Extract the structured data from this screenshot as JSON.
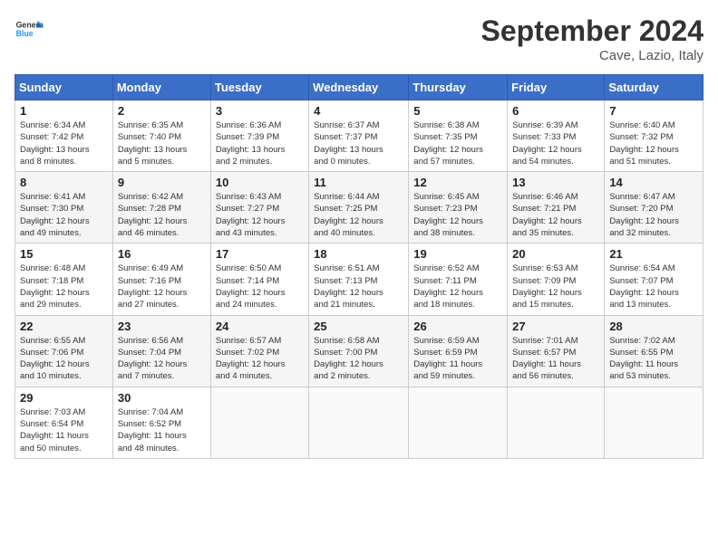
{
  "header": {
    "logo_general": "General",
    "logo_blue": "Blue",
    "month_title": "September 2024",
    "location": "Cave, Lazio, Italy"
  },
  "days_of_week": [
    "Sunday",
    "Monday",
    "Tuesday",
    "Wednesday",
    "Thursday",
    "Friday",
    "Saturday"
  ],
  "weeks": [
    [
      {
        "day": "1",
        "info": "Sunrise: 6:34 AM\nSunset: 7:42 PM\nDaylight: 13 hours\nand 8 minutes."
      },
      {
        "day": "2",
        "info": "Sunrise: 6:35 AM\nSunset: 7:40 PM\nDaylight: 13 hours\nand 5 minutes."
      },
      {
        "day": "3",
        "info": "Sunrise: 6:36 AM\nSunset: 7:39 PM\nDaylight: 13 hours\nand 2 minutes."
      },
      {
        "day": "4",
        "info": "Sunrise: 6:37 AM\nSunset: 7:37 PM\nDaylight: 13 hours\nand 0 minutes."
      },
      {
        "day": "5",
        "info": "Sunrise: 6:38 AM\nSunset: 7:35 PM\nDaylight: 12 hours\nand 57 minutes."
      },
      {
        "day": "6",
        "info": "Sunrise: 6:39 AM\nSunset: 7:33 PM\nDaylight: 12 hours\nand 54 minutes."
      },
      {
        "day": "7",
        "info": "Sunrise: 6:40 AM\nSunset: 7:32 PM\nDaylight: 12 hours\nand 51 minutes."
      }
    ],
    [
      {
        "day": "8",
        "info": "Sunrise: 6:41 AM\nSunset: 7:30 PM\nDaylight: 12 hours\nand 49 minutes."
      },
      {
        "day": "9",
        "info": "Sunrise: 6:42 AM\nSunset: 7:28 PM\nDaylight: 12 hours\nand 46 minutes."
      },
      {
        "day": "10",
        "info": "Sunrise: 6:43 AM\nSunset: 7:27 PM\nDaylight: 12 hours\nand 43 minutes."
      },
      {
        "day": "11",
        "info": "Sunrise: 6:44 AM\nSunset: 7:25 PM\nDaylight: 12 hours\nand 40 minutes."
      },
      {
        "day": "12",
        "info": "Sunrise: 6:45 AM\nSunset: 7:23 PM\nDaylight: 12 hours\nand 38 minutes."
      },
      {
        "day": "13",
        "info": "Sunrise: 6:46 AM\nSunset: 7:21 PM\nDaylight: 12 hours\nand 35 minutes."
      },
      {
        "day": "14",
        "info": "Sunrise: 6:47 AM\nSunset: 7:20 PM\nDaylight: 12 hours\nand 32 minutes."
      }
    ],
    [
      {
        "day": "15",
        "info": "Sunrise: 6:48 AM\nSunset: 7:18 PM\nDaylight: 12 hours\nand 29 minutes."
      },
      {
        "day": "16",
        "info": "Sunrise: 6:49 AM\nSunset: 7:16 PM\nDaylight: 12 hours\nand 27 minutes."
      },
      {
        "day": "17",
        "info": "Sunrise: 6:50 AM\nSunset: 7:14 PM\nDaylight: 12 hours\nand 24 minutes."
      },
      {
        "day": "18",
        "info": "Sunrise: 6:51 AM\nSunset: 7:13 PM\nDaylight: 12 hours\nand 21 minutes."
      },
      {
        "day": "19",
        "info": "Sunrise: 6:52 AM\nSunset: 7:11 PM\nDaylight: 12 hours\nand 18 minutes."
      },
      {
        "day": "20",
        "info": "Sunrise: 6:53 AM\nSunset: 7:09 PM\nDaylight: 12 hours\nand 15 minutes."
      },
      {
        "day": "21",
        "info": "Sunrise: 6:54 AM\nSunset: 7:07 PM\nDaylight: 12 hours\nand 13 minutes."
      }
    ],
    [
      {
        "day": "22",
        "info": "Sunrise: 6:55 AM\nSunset: 7:06 PM\nDaylight: 12 hours\nand 10 minutes."
      },
      {
        "day": "23",
        "info": "Sunrise: 6:56 AM\nSunset: 7:04 PM\nDaylight: 12 hours\nand 7 minutes."
      },
      {
        "day": "24",
        "info": "Sunrise: 6:57 AM\nSunset: 7:02 PM\nDaylight: 12 hours\nand 4 minutes."
      },
      {
        "day": "25",
        "info": "Sunrise: 6:58 AM\nSunset: 7:00 PM\nDaylight: 12 hours\nand 2 minutes."
      },
      {
        "day": "26",
        "info": "Sunrise: 6:59 AM\nSunset: 6:59 PM\nDaylight: 11 hours\nand 59 minutes."
      },
      {
        "day": "27",
        "info": "Sunrise: 7:01 AM\nSunset: 6:57 PM\nDaylight: 11 hours\nand 56 minutes."
      },
      {
        "day": "28",
        "info": "Sunrise: 7:02 AM\nSunset: 6:55 PM\nDaylight: 11 hours\nand 53 minutes."
      }
    ],
    [
      {
        "day": "29",
        "info": "Sunrise: 7:03 AM\nSunset: 6:54 PM\nDaylight: 11 hours\nand 50 minutes."
      },
      {
        "day": "30",
        "info": "Sunrise: 7:04 AM\nSunset: 6:52 PM\nDaylight: 11 hours\nand 48 minutes."
      },
      {
        "day": "",
        "info": ""
      },
      {
        "day": "",
        "info": ""
      },
      {
        "day": "",
        "info": ""
      },
      {
        "day": "",
        "info": ""
      },
      {
        "day": "",
        "info": ""
      }
    ]
  ]
}
